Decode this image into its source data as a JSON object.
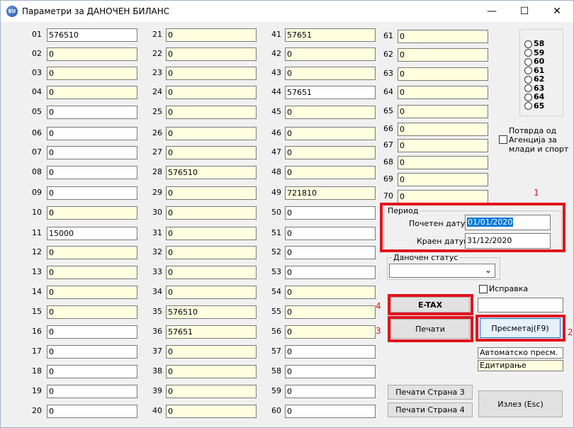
{
  "window": {
    "title": "Параметри за ДАНОЧЕН БИЛАНС",
    "icon_text": "EU",
    "minimize": "—",
    "maximize": "☐",
    "close": "✕"
  },
  "rows": [
    {
      "label": "01",
      "value": "576510"
    },
    {
      "label": "02",
      "value": "0"
    },
    {
      "label": "03",
      "value": "0"
    },
    {
      "label": "04",
      "value": "0"
    },
    {
      "label": "05",
      "value": "0"
    },
    {
      "label": "06",
      "value": "0"
    },
    {
      "label": "07",
      "value": "0"
    },
    {
      "label": "08",
      "value": "0"
    },
    {
      "label": "09",
      "value": "0"
    },
    {
      "label": "10",
      "value": "0"
    },
    {
      "label": "11",
      "value": "15000"
    },
    {
      "label": "12",
      "value": "0"
    },
    {
      "label": "13",
      "value": "0"
    },
    {
      "label": "14",
      "value": "0"
    },
    {
      "label": "15",
      "value": "0"
    },
    {
      "label": "16",
      "value": "0"
    },
    {
      "label": "17",
      "value": "0"
    },
    {
      "label": "18",
      "value": "0"
    },
    {
      "label": "19",
      "value": "0"
    },
    {
      "label": "20",
      "value": "0"
    },
    {
      "label": "21",
      "value": "0"
    },
    {
      "label": "22",
      "value": "0"
    },
    {
      "label": "23",
      "value": "0"
    },
    {
      "label": "24",
      "value": "0"
    },
    {
      "label": "25",
      "value": "0"
    },
    {
      "label": "26",
      "value": "0"
    },
    {
      "label": "27",
      "value": "0"
    },
    {
      "label": "28",
      "value": "576510"
    },
    {
      "label": "29",
      "value": "0"
    },
    {
      "label": "30",
      "value": "0"
    },
    {
      "label": "31",
      "value": "0"
    },
    {
      "label": "32",
      "value": "0"
    },
    {
      "label": "33",
      "value": "0"
    },
    {
      "label": "34",
      "value": "0"
    },
    {
      "label": "35",
      "value": "576510"
    },
    {
      "label": "36",
      "value": "57651"
    },
    {
      "label": "37",
      "value": "0"
    },
    {
      "label": "38",
      "value": "0"
    },
    {
      "label": "39",
      "value": "0"
    },
    {
      "label": "40",
      "value": "0"
    },
    {
      "label": "41",
      "value": "57651"
    },
    {
      "label": "42",
      "value": "0"
    },
    {
      "label": "43",
      "value": "0"
    },
    {
      "label": "44",
      "value": "57651"
    },
    {
      "label": "45",
      "value": "0"
    },
    {
      "label": "46",
      "value": "0"
    },
    {
      "label": "47",
      "value": "0"
    },
    {
      "label": "48",
      "value": "0"
    },
    {
      "label": "49",
      "value": "721810"
    },
    {
      "label": "50",
      "value": "0"
    },
    {
      "label": "51",
      "value": "0"
    },
    {
      "label": "52",
      "value": "0"
    },
    {
      "label": "53",
      "value": "0"
    },
    {
      "label": "54",
      "value": "0"
    },
    {
      "label": "55",
      "value": "0"
    },
    {
      "label": "56",
      "value": "0"
    },
    {
      "label": "57",
      "value": "0"
    },
    {
      "label": "58",
      "value": "0"
    },
    {
      "label": "59",
      "value": "0"
    },
    {
      "label": "60",
      "value": "0"
    },
    {
      "label": "61",
      "value": "0"
    },
    {
      "label": "62",
      "value": "0"
    },
    {
      "label": "63",
      "value": "0"
    },
    {
      "label": "64",
      "value": "0"
    },
    {
      "label": "65",
      "value": "0"
    },
    {
      "label": "66",
      "value": "0"
    },
    {
      "label": "67",
      "value": "0"
    },
    {
      "label": "68",
      "value": "0"
    },
    {
      "label": "69",
      "value": "0"
    },
    {
      "label": "70",
      "value": "0"
    }
  ],
  "radio_options": [
    "58",
    "59",
    "60",
    "61",
    "62",
    "63",
    "64",
    "65"
  ],
  "agency_check": "Потврда од Агенција за млади и спорт",
  "period": {
    "title": "Период",
    "start_label": "Почетен датум",
    "start_value": "01/01/2020",
    "end_label": "Краен датум",
    "end_value": "31/12/2020"
  },
  "tax_status": {
    "label": "Даночен статус",
    "value": ""
  },
  "correction": {
    "label": "Исправка",
    "value": ""
  },
  "buttons": {
    "etax": "E-TAX",
    "print": "Печати",
    "calculate": "Пресметај(F9)",
    "print_page3": "Печати Страна 3",
    "print_page4": "Печати Страна 4",
    "exit": "Излез (Esc)"
  },
  "status": {
    "auto_calc": "Автоматско пресм.",
    "editing": "Едитирање"
  },
  "markers": [
    "1",
    "2",
    "3",
    "4"
  ],
  "colors": {
    "highlight": "#e0141e",
    "yellow_field": "#ffffe0",
    "selection": "#0078d7"
  }
}
